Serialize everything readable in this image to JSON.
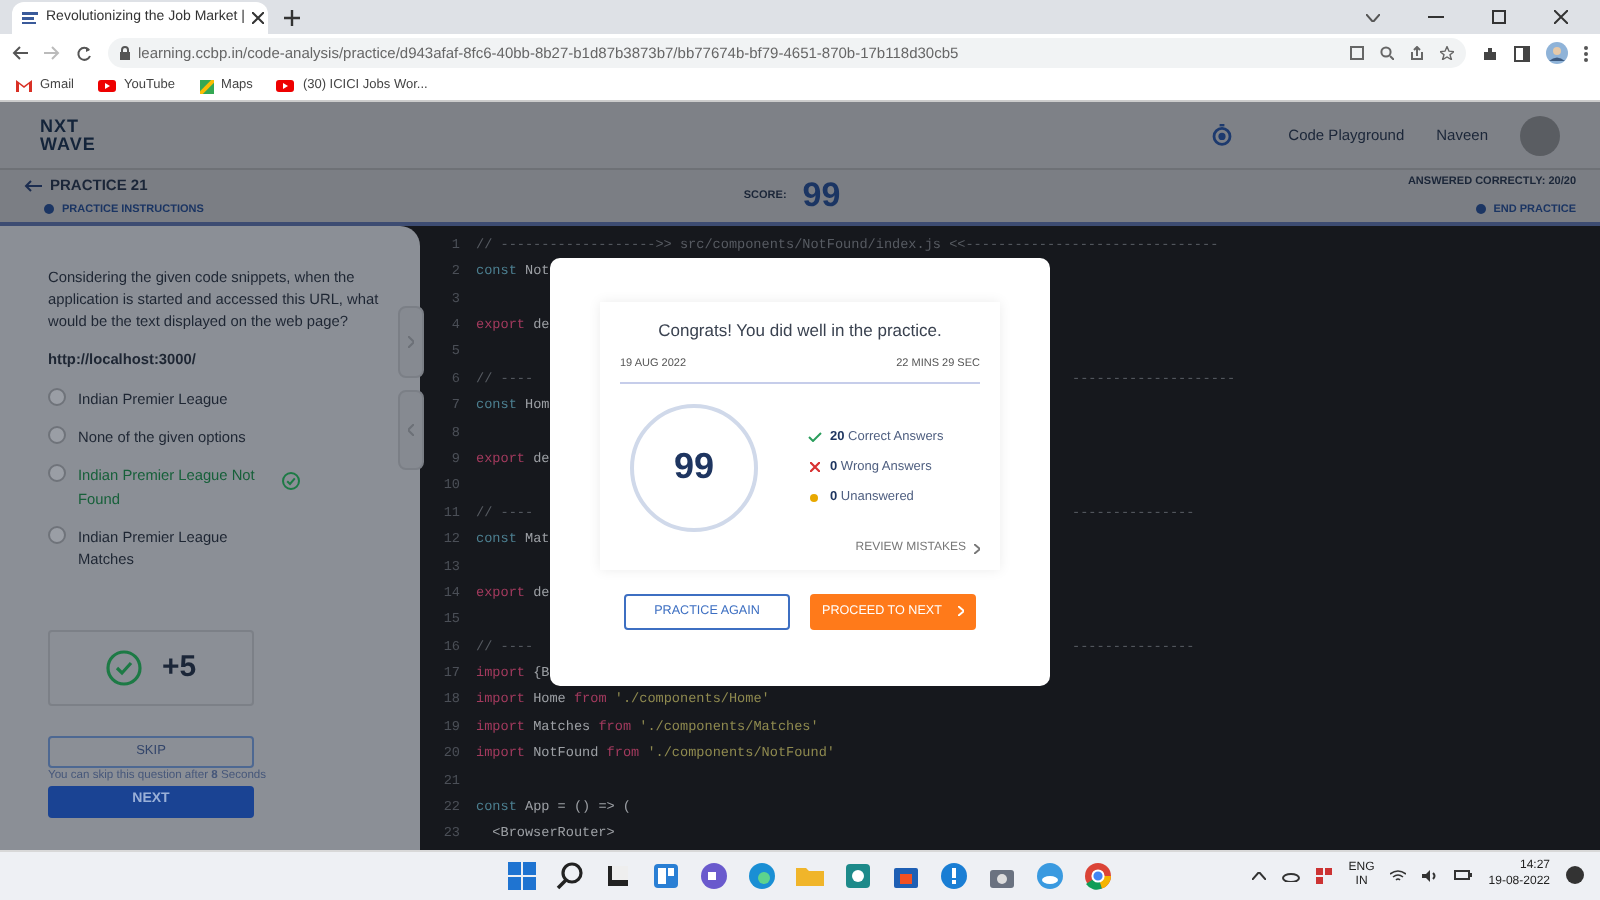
{
  "browser": {
    "tab_title": "Revolutionizing the Job Market |",
    "url": "learning.ccbp.in/code-analysis/practice/d943afaf-8fc6-40bb-8b27-b1d87b3873b7/bb77674b-bf79-4651-870b-17b118d30cb5",
    "bookmarks": [
      {
        "label": "Gmail",
        "kind": "gmail"
      },
      {
        "label": "YouTube",
        "kind": "youtube"
      },
      {
        "label": "Maps",
        "kind": "maps"
      },
      {
        "label": "(30) ICICI Jobs Wor...",
        "kind": "youtube"
      }
    ]
  },
  "header": {
    "logo_top": "NXT",
    "logo_bottom": "WAVE",
    "link": "Code Playground",
    "user": "Naveen"
  },
  "practice_bar": {
    "title": "PRACTICE 21",
    "instructions": "PRACTICE INSTRUCTIONS",
    "score_label": "SCORE:",
    "score": "99",
    "answered": "ANSWERED CORRECTLY: 20/20",
    "end": "END PRACTICE"
  },
  "question": {
    "text": "Considering the given code snippets, when the application is started and accessed this URL, what would be the text displayed on the web page?",
    "url": "http://localhost:3000/",
    "options": [
      {
        "label": "Indian Premier League",
        "correct": false,
        "selected": false
      },
      {
        "label": "None of the given options",
        "correct": false,
        "selected": false
      },
      {
        "label": "Indian Premier League Not Found",
        "correct": true,
        "selected": false
      },
      {
        "label": "Indian Premier League Matches",
        "correct": false,
        "selected": false
      }
    ],
    "points": "+5",
    "skip": {
      "label": "SKIP",
      "disabled": true
    },
    "skip_note": "You can skip this question after **8** Seconds",
    "next": "NEXT"
  },
  "code_lines": [
    {
      "n": "1",
      "tokens": [
        {
          "text": "// ------------------->> src/components/NotFound/index.js <<-------------------------------",
          "kind": "comment"
        }
      ]
    },
    {
      "n": "2",
      "tokens": [
        {
          "text": "const",
          "kind": "decl"
        },
        {
          "text": " Not",
          "kind": "plain"
        }
      ]
    },
    {
      "n": "3"
    },
    {
      "n": "4",
      "tokens": [
        {
          "text": "export",
          "kind": "keyword"
        },
        {
          "text": " de",
          "kind": "plain"
        }
      ]
    },
    {
      "n": "5"
    },
    {
      "n": "6",
      "tokens": [
        {
          "text": "// ----",
          "kind": "comment"
        }
      ],
      "tail": "--------------------"
    },
    {
      "n": "7",
      "tokens": [
        {
          "text": "const",
          "kind": "decl"
        },
        {
          "text": " Hom",
          "kind": "plain"
        }
      ]
    },
    {
      "n": "8"
    },
    {
      "n": "9",
      "tokens": [
        {
          "text": "export",
          "kind": "keyword"
        },
        {
          "text": " de",
          "kind": "plain"
        }
      ]
    },
    {
      "n": "10"
    },
    {
      "n": "11",
      "tokens": [
        {
          "text": "// ----",
          "kind": "comment"
        }
      ],
      "tail": "---------------"
    },
    {
      "n": "12",
      "tokens": [
        {
          "text": "const",
          "kind": "decl"
        },
        {
          "text": " Mat",
          "kind": "plain"
        }
      ]
    },
    {
      "n": "13"
    },
    {
      "n": "14",
      "tokens": [
        {
          "text": "export",
          "kind": "keyword"
        },
        {
          "text": " de",
          "kind": "plain"
        }
      ]
    },
    {
      "n": "15"
    },
    {
      "n": "16",
      "tokens": [
        {
          "text": "// ----",
          "kind": "comment"
        }
      ],
      "tail": "---------------"
    },
    {
      "n": "17",
      "tokens": [
        {
          "text": "import",
          "kind": "keyword"
        },
        {
          "text": " {B",
          "kind": "plain"
        }
      ]
    },
    {
      "n": "18",
      "tokens": [
        {
          "text": "import",
          "kind": "keyword"
        },
        {
          "text": " Home ",
          "kind": "plain"
        },
        {
          "text": "from",
          "kind": "keyword"
        },
        {
          "text": " './components/Home'",
          "kind": "string"
        }
      ]
    },
    {
      "n": "19",
      "tokens": [
        {
          "text": "import",
          "kind": "keyword"
        },
        {
          "text": " Matches ",
          "kind": "plain"
        },
        {
          "text": "from",
          "kind": "keyword"
        },
        {
          "text": " './components/Matches'",
          "kind": "string"
        }
      ]
    },
    {
      "n": "20",
      "tokens": [
        {
          "text": "import",
          "kind": "keyword"
        },
        {
          "text": " NotFound ",
          "kind": "plain"
        },
        {
          "text": "from",
          "kind": "keyword"
        },
        {
          "text": " './components/NotFound'",
          "kind": "string"
        }
      ]
    },
    {
      "n": "21"
    },
    {
      "n": "22",
      "tokens": [
        {
          "text": "const",
          "kind": "decl"
        },
        {
          "text": " App = () => (",
          "kind": "plain"
        }
      ]
    },
    {
      "n": "23",
      "tokens": [
        {
          "text": "  <BrowserRouter>",
          "kind": "plain"
        }
      ]
    }
  ],
  "modal": {
    "title": "Congrats! You did well in the practice.",
    "date": "19 AUG 2022",
    "duration": "22 MINS 29 SEC",
    "score": "99",
    "stats": [
      {
        "kind": "correct",
        "count": "20",
        "label": "Correct Answers"
      },
      {
        "kind": "wrong",
        "count": "0",
        "label": "Wrong Answers"
      },
      {
        "kind": "unanswered",
        "count": "0",
        "label": "Unanswered"
      }
    ],
    "review": "REVIEW MISTAKES",
    "again": "PRACTICE AGAIN",
    "proceed": "PROCEED TO NEXT"
  },
  "taskbar": {
    "lang_top": "ENG",
    "lang_bottom": "IN",
    "time": "14:27",
    "date": "19-08-2022"
  }
}
